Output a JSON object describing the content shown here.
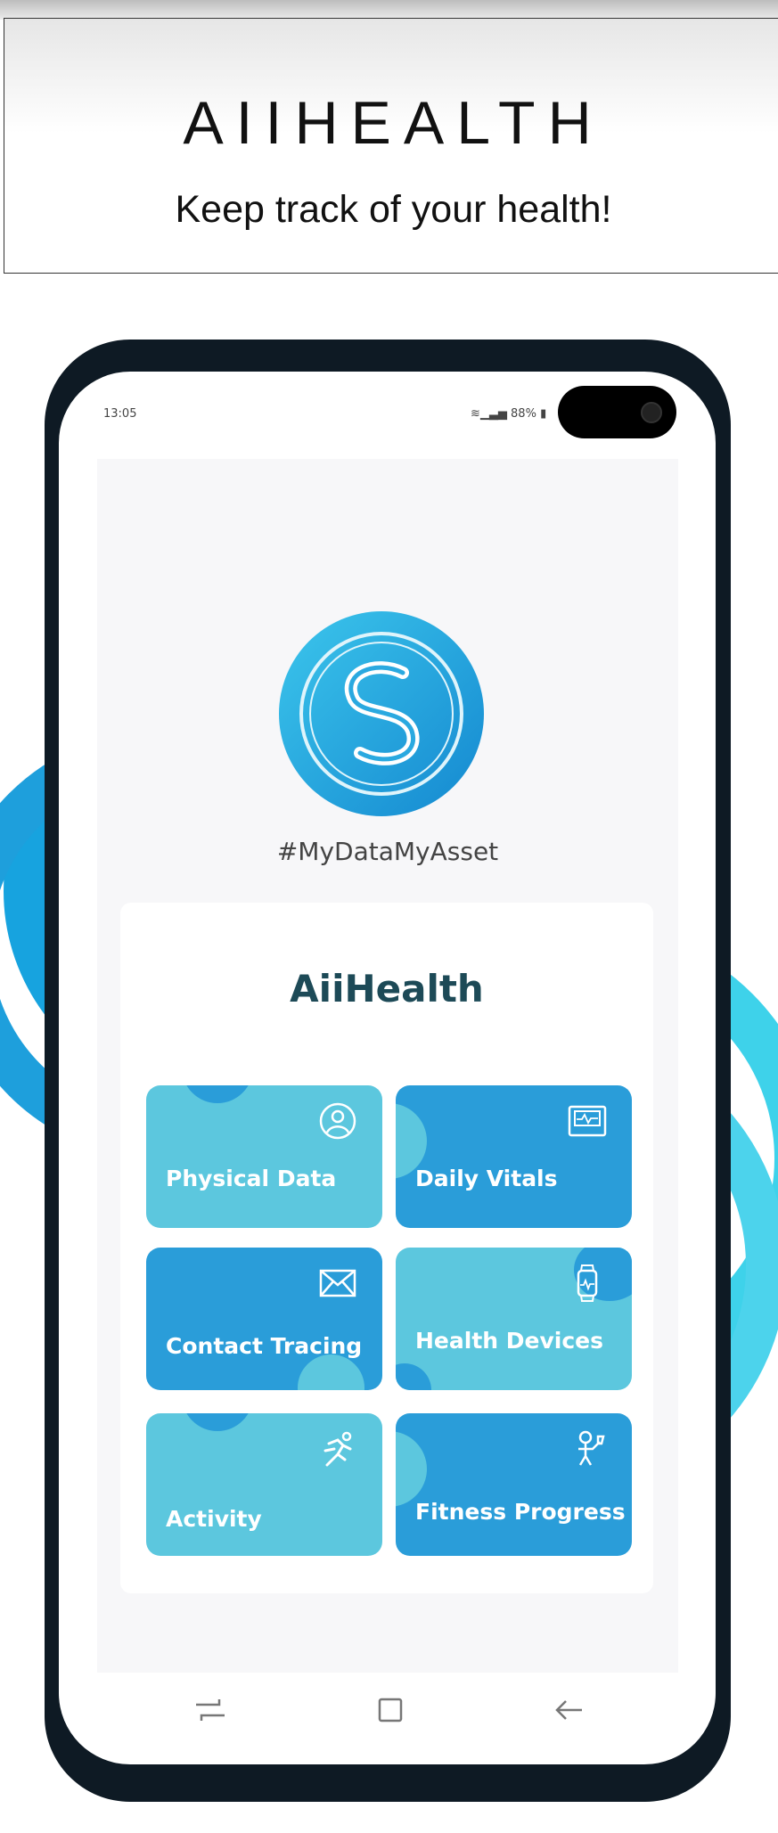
{
  "header": {
    "brand": "AIIHEALTH",
    "tagline": "Keep track of your health!"
  },
  "status_bar": {
    "time": "13:05",
    "battery": "88%"
  },
  "app": {
    "hashtag": "#MyDataMyAsset",
    "title": "AiiHealth"
  },
  "tiles": [
    {
      "label": "Physical Data",
      "icon": "user-circle-icon"
    },
    {
      "label": "Daily Vitals",
      "icon": "monitor-icon"
    },
    {
      "label": "Contact Tracing",
      "icon": "envelope-icon"
    },
    {
      "label": "Health Devices",
      "icon": "smartwatch-icon"
    },
    {
      "label": "Activity",
      "icon": "running-icon"
    },
    {
      "label": "Fitness Progress",
      "icon": "trophy-person-icon"
    }
  ],
  "colors": {
    "tile_light": "#5cc7de",
    "tile_dark": "#2a9dd9",
    "title": "#1d4a57",
    "ring_left": "#17a3df",
    "ring_right": "#3ed2ea"
  }
}
